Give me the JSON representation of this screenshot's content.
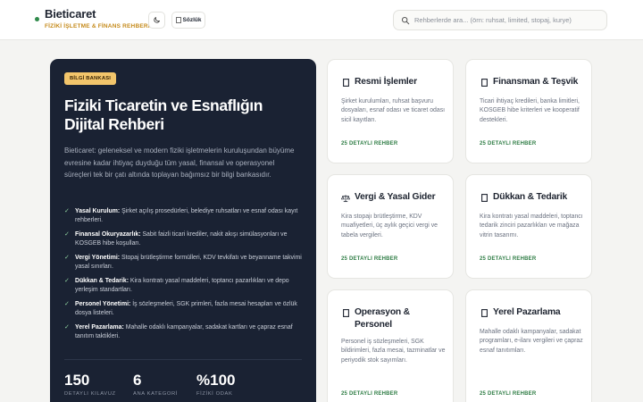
{
  "header": {
    "brand_title": "Bieticaret",
    "brand_subtitle": "FİZİKİ İŞLETME & FİNANS REHBERİ",
    "dictionary_label": "Sözlük",
    "search_placeholder": "Rehberlerde ara... (örn: ruhsat, limited, stopaj, kurye)"
  },
  "hero": {
    "badge": "BİLGİ BANKASI",
    "title": "Fiziki Ticaretin ve Esnaflığın Dijital Rehberi",
    "description": "Bieticaret: geleneksel ve modern fiziki işletmelerin kuruluşundan büyüme evresine kadar ihtiyaç duyduğu tüm yasal, finansal ve operasyonel süreçleri tek bir çatı altında toplayan bağımsız bir bilgi bankasıdır.",
    "features": [
      {
        "title": "Yasal Kurulum:",
        "text": "Şirket açılış prosedürleri, belediye ruhsatları ve esnaf odası kayıt rehberleri."
      },
      {
        "title": "Finansal Okuryazarlık:",
        "text": "Sabit faizli ticari krediler, nakit akışı simülasyonları ve KOSGEB hibe koşulları."
      },
      {
        "title": "Vergi Yönetimi:",
        "text": "Stopaj brütleştirme formülleri, KDV tevkifatı ve beyanname takvimi yasal sınırları."
      },
      {
        "title": "Dükkan & Tedarik:",
        "text": "Kira kontratı yasal maddeleri, toptancı pazarlıkları ve depo yerleşim standartları."
      },
      {
        "title": "Personel Yönetimi:",
        "text": "İş sözleşmeleri, SGK primleri, fazla mesai hesapları ve özlük dosya listeleri."
      },
      {
        "title": "Yerel Pazarlama:",
        "text": "Mahalle odaklı kampanyalar, sadakat kartları ve çapraz esnaf tanıtım taktikleri."
      }
    ],
    "check_glyph": "✓",
    "stats": [
      {
        "number": "150",
        "label": "DETAYLI KILAVUZ"
      },
      {
        "number": "6",
        "label": "ANA KATEGORİ"
      },
      {
        "number": "%100",
        "label": "FİZİKİ ODAK"
      }
    ]
  },
  "cards": [
    {
      "icon": "document-icon",
      "title": "Resmi İşlemler",
      "description": "Şirket kurulumları, ruhsat başvuru dosyaları, esnaf odası ve ticaret odası sicil kayıtları.",
      "link": "25 DETAYLI REHBER"
    },
    {
      "icon": "money-icon",
      "title": "Finansman & Teşvik",
      "description": "Ticari ihtiyaç kredileri, banka limitleri, KOSGEB hibe kriterleri ve kooperatif destekleri.",
      "link": "25 DETAYLI REHBER"
    },
    {
      "icon": "scale-icon",
      "title": "Vergi & Yasal Gider",
      "description": "Kira stopajı brütleştirme, KDV muafiyetleri, üç aylık geçici vergi ve tabela vergileri.",
      "link": "25 DETAYLI REHBER"
    },
    {
      "icon": "store-icon",
      "title": "Dükkan & Tedarik",
      "description": "Kira kontratı yasal maddeleri, toptancı tedarik zinciri pazarlıkları ve mağaza vitrin tasarımı.",
      "link": "25 DETAYLI REHBER"
    },
    {
      "icon": "people-icon",
      "title": "Operasyon & Personel",
      "description": "Personel iş sözleşmeleri, SGK bildirimleri, fazla mesai, tazminatlar ve periyodik stok sayımları.",
      "link": "25 DETAYLI REHBER"
    },
    {
      "icon": "megaphone-icon",
      "title": "Yerel Pazarlama",
      "description": "Mahalle odaklı kampanyalar, sadakat programları, e-ilanı vergileri ve çapraz esnaf tanıtımları.",
      "link": "25 DETAYLI REHBER"
    }
  ],
  "colors": {
    "accent_green": "#2f7d45",
    "badge_gold": "#f2c56b",
    "hero_bg": "#1a2233",
    "subtitle_gold": "#c58a1a"
  }
}
